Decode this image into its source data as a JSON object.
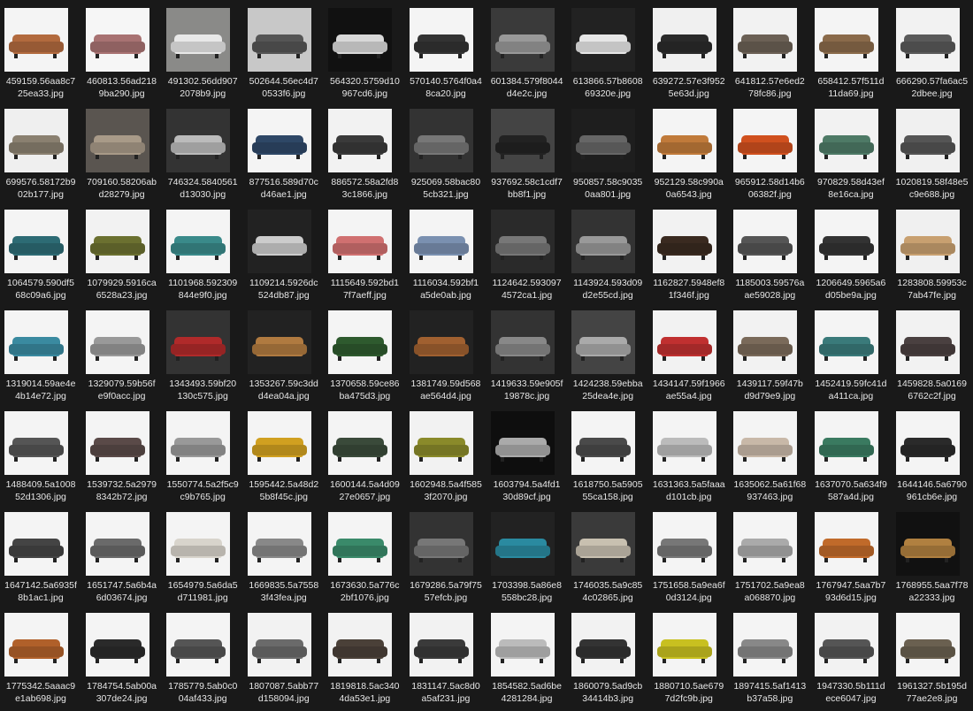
{
  "files": [
    {
      "l1": "459159.56aa8c7",
      "l2": "25ea33.jpg",
      "bg": "#f4f4f4",
      "sofa": "#b26a3e"
    },
    {
      "l1": "460813.56ad218",
      "l2": "9ba290.jpg",
      "bg": "#f6f6f6",
      "sofa": "#a87272"
    },
    {
      "l1": "491302.56dd907",
      "l2": "2078b9.jpg",
      "bg": "#8a8a88",
      "sofa": "#e8e8e8"
    },
    {
      "l1": "502644.56ec4d7",
      "l2": "0533f6.jpg",
      "bg": "#c8c8c8",
      "sofa": "#555555"
    },
    {
      "l1": "564320.5759d10",
      "l2": "967cd6.jpg",
      "bg": "#111111",
      "sofa": "#d8d8d8"
    },
    {
      "l1": "570140.5764f0a4",
      "l2": "8ca20.jpg",
      "bg": "#f4f4f4",
      "sofa": "#333333"
    },
    {
      "l1": "601384.579f8044",
      "l2": "d4e2c.jpg",
      "bg": "#3a3a3a",
      "sofa": "#999999"
    },
    {
      "l1": "613866.57b8608",
      "l2": "69320e.jpg",
      "bg": "#222222",
      "sofa": "#e6e6e6"
    },
    {
      "l1": "639272.57e3f952",
      "l2": "5e63d.jpg",
      "bg": "#f0f0f0",
      "sofa": "#2a2a2a"
    },
    {
      "l1": "641812.57e6ed2",
      "l2": "78fc86.jpg",
      "bg": "#f2f2f2",
      "sofa": "#6b6055"
    },
    {
      "l1": "658412.57f511d",
      "l2": "11da69.jpg",
      "bg": "#f4f4f4",
      "sofa": "#8a6a4a"
    },
    {
      "l1": "666290.57fa6ac5",
      "l2": "2dbee.jpg",
      "bg": "#f2f2f2",
      "sofa": "#5a5a5a"
    },
    {
      "l1": "699576.58172b9",
      "l2": "02b177.jpg",
      "bg": "#efefef",
      "sofa": "#8a8070"
    },
    {
      "l1": "709160.58206ab",
      "l2": "d28279.jpg",
      "bg": "#5a5550",
      "sofa": "#a89a88"
    },
    {
      "l1": "746324.5840561",
      "l2": "d13030.jpg",
      "bg": "#333333",
      "sofa": "#bbbbbb"
    },
    {
      "l1": "877516.589d70c",
      "l2": "d46ae1.jpg",
      "bg": "#f4f4f4",
      "sofa": "#2e4766"
    },
    {
      "l1": "886572.58a2fd8",
      "l2": "3c1866.jpg",
      "bg": "#f2f2f2",
      "sofa": "#3a3a3a"
    },
    {
      "l1": "925069.58bac80",
      "l2": "5cb321.jpg",
      "bg": "#333333",
      "sofa": "#777777"
    },
    {
      "l1": "937692.58c1cdf7",
      "l2": "bb8f1.jpg",
      "bg": "#444444",
      "sofa": "#222222"
    },
    {
      "l1": "950857.58c9035",
      "l2": "0aa801.jpg",
      "bg": "#1e1e1e",
      "sofa": "#666666"
    },
    {
      "l1": "952129.58c990a",
      "l2": "0a6543.jpg",
      "bg": "#f4f4f4",
      "sofa": "#c07a3a"
    },
    {
      "l1": "965912.58d14b6",
      "l2": "06382f.jpg",
      "bg": "#f4f4f4",
      "sofa": "#d0501e"
    },
    {
      "l1": "970829.58d43ef",
      "l2": "8e16ca.jpg",
      "bg": "#f2f2f2",
      "sofa": "#4e7a66"
    },
    {
      "l1": "1020819.58f48e5",
      "l2": "c9e688.jpg",
      "bg": "#f0f0f0",
      "sofa": "#555555"
    },
    {
      "l1": "1064579.590df5",
      "l2": "68c09a6.jpg",
      "bg": "#f4f4f4",
      "sofa": "#2d6b74"
    },
    {
      "l1": "1079929.5916ca",
      "l2": "6528a23.jpg",
      "bg": "#f2f2f2",
      "sofa": "#6b7030"
    },
    {
      "l1": "1101968.592309",
      "l2": "844e9f0.jpg",
      "bg": "#f4f4f4",
      "sofa": "#3a8a8a"
    },
    {
      "l1": "1109214.5926dc",
      "l2": "524db87.jpg",
      "bg": "#222222",
      "sofa": "#cccccc"
    },
    {
      "l1": "1115649.592bd1",
      "l2": "7f7aeff.jpg",
      "bg": "#f4f4f4",
      "sofa": "#d07070"
    },
    {
      "l1": "1116034.592bf1",
      "l2": "a5de0ab.jpg",
      "bg": "#f4f4f4",
      "sofa": "#7a90b0"
    },
    {
      "l1": "1124642.593097",
      "l2": "4572ca1.jpg",
      "bg": "#2a2a2a",
      "sofa": "#777777"
    },
    {
      "l1": "1143924.593d09",
      "l2": "d2e55cd.jpg",
      "bg": "#333333",
      "sofa": "#999999"
    },
    {
      "l1": "1162827.5948ef8",
      "l2": "1f346f.jpg",
      "bg": "#f2f2f2",
      "sofa": "#3a2a20"
    },
    {
      "l1": "1185003.59576a",
      "l2": "ae59028.jpg",
      "bg": "#f4f4f4",
      "sofa": "#555555"
    },
    {
      "l1": "1206649.5965a6",
      "l2": "d05be9a.jpg",
      "bg": "#f4f4f4",
      "sofa": "#333333"
    },
    {
      "l1": "1283808.59953c",
      "l2": "7ab47fe.jpg",
      "bg": "#f0f0f0",
      "sofa": "#c8a070"
    },
    {
      "l1": "1319014.59ae4e",
      "l2": "4b14e72.jpg",
      "bg": "#f4f4f4",
      "sofa": "#3a8aa0"
    },
    {
      "l1": "1329079.59b56f",
      "l2": "e9f0acc.jpg",
      "bg": "#f4f4f4",
      "sofa": "#999999"
    },
    {
      "l1": "1343493.59bf20",
      "l2": "130c575.jpg",
      "bg": "#333333",
      "sofa": "#b02a2a"
    },
    {
      "l1": "1353267.59c3dd",
      "l2": "d4ea04a.jpg",
      "bg": "#222222",
      "sofa": "#b07a40"
    },
    {
      "l1": "1370658.59ce86",
      "l2": "ba475d3.jpg",
      "bg": "#f4f4f4",
      "sofa": "#2e5a2e"
    },
    {
      "l1": "1381749.59d568",
      "l2": "ae564d4.jpg",
      "bg": "#222222",
      "sofa": "#a06030"
    },
    {
      "l1": "1419633.59e905f",
      "l2": "19878c.jpg",
      "bg": "#333333",
      "sofa": "#888888"
    },
    {
      "l1": "1424238.59ebba",
      "l2": "25dea4e.jpg",
      "bg": "#444444",
      "sofa": "#aaaaaa"
    },
    {
      "l1": "1434147.59f1966",
      "l2": "ae55a4.jpg",
      "bg": "#f2f2f2",
      "sofa": "#c03030"
    },
    {
      "l1": "1439117.59f47b",
      "l2": "d9d79e9.jpg",
      "bg": "#f2f2f2",
      "sofa": "#7a6a5a"
    },
    {
      "l1": "1452419.59fc41d",
      "l2": "a411ca.jpg",
      "bg": "#f4f4f4",
      "sofa": "#3a7a7a"
    },
    {
      "l1": "1459828.5a0169",
      "l2": "6762c2f.jpg",
      "bg": "#f2f2f2",
      "sofa": "#4a4040"
    },
    {
      "l1": "1488409.5a1008",
      "l2": "52d1306.jpg",
      "bg": "#f4f4f4",
      "sofa": "#555555"
    },
    {
      "l1": "1539732.5a2979",
      "l2": "8342b72.jpg",
      "bg": "#f4f4f4",
      "sofa": "#5a4a48"
    },
    {
      "l1": "1550774.5a2f5c9",
      "l2": "c9b765.jpg",
      "bg": "#f4f4f4",
      "sofa": "#999999"
    },
    {
      "l1": "1595442.5a48d2",
      "l2": "5b8f45c.jpg",
      "bg": "#f4f4f4",
      "sofa": "#d0a020"
    },
    {
      "l1": "1600144.5a4d09",
      "l2": "27e0657.jpg",
      "bg": "#f4f4f4",
      "sofa": "#3a4a3a"
    },
    {
      "l1": "1602948.5a4f585",
      "l2": "3f2070.jpg",
      "bg": "#f2f2f2",
      "sofa": "#8a8a2a"
    },
    {
      "l1": "1603794.5a4fd1",
      "l2": "30d89cf.jpg",
      "bg": "#0e0e0e",
      "sofa": "#aaaaaa"
    },
    {
      "l1": "1618750.5a5905",
      "l2": "55ca158.jpg",
      "bg": "#f4f4f4",
      "sofa": "#4a4a4a"
    },
    {
      "l1": "1631363.5a5faaa",
      "l2": "d101cb.jpg",
      "bg": "#f4f4f4",
      "sofa": "#bbbbbb"
    },
    {
      "l1": "1635062.5a61f68",
      "l2": "937463.jpg",
      "bg": "#f4f4f4",
      "sofa": "#c8b8a8"
    },
    {
      "l1": "1637070.5a634f9",
      "l2": "587a4d.jpg",
      "bg": "#f4f4f4",
      "sofa": "#3a7a60"
    },
    {
      "l1": "1644146.5a6790",
      "l2": "961cb6e.jpg",
      "bg": "#f4f4f4",
      "sofa": "#2a2a2a"
    },
    {
      "l1": "1647142.5a6935f",
      "l2": "8b1ac1.jpg",
      "bg": "#f4f4f4",
      "sofa": "#444444"
    },
    {
      "l1": "1651747.5a6b4a",
      "l2": "6d03674.jpg",
      "bg": "#f4f4f4",
      "sofa": "#6a6a6a"
    },
    {
      "l1": "1654979.5a6da5",
      "l2": "d711981.jpg",
      "bg": "#f4f4f4",
      "sofa": "#d8d4cc"
    },
    {
      "l1": "1669835.5a7558",
      "l2": "3f43fea.jpg",
      "bg": "#f4f4f4",
      "sofa": "#888888"
    },
    {
      "l1": "1673630.5a776c",
      "l2": "2bf1076.jpg",
      "bg": "#f4f4f4",
      "sofa": "#3a8a6a"
    },
    {
      "l1": "1679286.5a79f75",
      "l2": "57efcb.jpg",
      "bg": "#333333",
      "sofa": "#777777"
    },
    {
      "l1": "1703398.5a86e8",
      "l2": "558bc28.jpg",
      "bg": "#222222",
      "sofa": "#2a8aa0"
    },
    {
      "l1": "1746035.5a9c85",
      "l2": "4c02865.jpg",
      "bg": "#3a3a3a",
      "sofa": "#c8c0b0"
    },
    {
      "l1": "1751658.5a9ea6f",
      "l2": "0d3124.jpg",
      "bg": "#f4f4f4",
      "sofa": "#777777"
    },
    {
      "l1": "1751702.5a9ea8",
      "l2": "a068870.jpg",
      "bg": "#f4f4f4",
      "sofa": "#aaaaaa"
    },
    {
      "l1": "1767947.5aa7b7",
      "l2": "93d6d15.jpg",
      "bg": "#f4f4f4",
      "sofa": "#c06a2a"
    },
    {
      "l1": "1768955.5aa7f78",
      "l2": "a22333.jpg",
      "bg": "#111111",
      "sofa": "#b08040"
    },
    {
      "l1": "1775342.5aaac9",
      "l2": "e1ab698.jpg",
      "bg": "#f4f4f4",
      "sofa": "#b0602a"
    },
    {
      "l1": "1784754.5ab00a",
      "l2": "307de24.jpg",
      "bg": "#f4f4f4",
      "sofa": "#2a2a2a"
    },
    {
      "l1": "1785779.5ab0c0",
      "l2": "04af433.jpg",
      "bg": "#f4f4f4",
      "sofa": "#555555"
    },
    {
      "l1": "1807087.5abb77",
      "l2": "d158094.jpg",
      "bg": "#f2f2f2",
      "sofa": "#6a6a6a"
    },
    {
      "l1": "1819818.5ac340",
      "l2": "4da53e1.jpg",
      "bg": "#f2f2f2",
      "sofa": "#4a4038"
    },
    {
      "l1": "1831147.5ac8d0",
      "l2": "a5af231.jpg",
      "bg": "#f2f2f2",
      "sofa": "#3a3a3a"
    },
    {
      "l1": "1854582.5ad6be",
      "l2": "4281284.jpg",
      "bg": "#f4f4f4",
      "sofa": "#bbbbbb"
    },
    {
      "l1": "1860079.5ad9cb",
      "l2": "34414b3.jpg",
      "bg": "#f2f2f2",
      "sofa": "#333333"
    },
    {
      "l1": "1880710.5ae679",
      "l2": "7d2fc9b.jpg",
      "bg": "#f4f4f4",
      "sofa": "#c8c020"
    },
    {
      "l1": "1897415.5af1413",
      "l2": "b37a58.jpg",
      "bg": "#f4f4f4",
      "sofa": "#888888"
    },
    {
      "l1": "1947330.5b111d",
      "l2": "ece6047.jpg",
      "bg": "#f2f2f2",
      "sofa": "#555555"
    },
    {
      "l1": "1961327.5b195d",
      "l2": "77ae2e8.jpg",
      "bg": "#f4f4f4",
      "sofa": "#6a6050"
    }
  ]
}
